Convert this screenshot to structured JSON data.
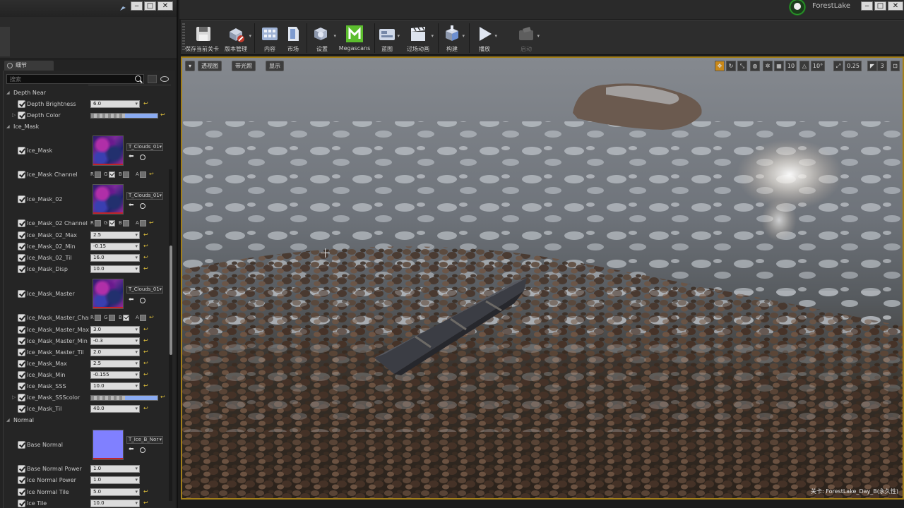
{
  "left_window": {
    "details_tab": "细节",
    "search": {
      "placeholder": "搜索"
    }
  },
  "details": {
    "categories": [
      "Depth Near",
      "Ice_Mask",
      "Normal"
    ],
    "rows": [
      {
        "label": "Depth Brightness",
        "value": "6.0"
      },
      {
        "label": "Depth Color"
      },
      {
        "label": "Ice_Mask",
        "asset": "T_Clouds_01"
      },
      {
        "label": "Ice_Mask Channel"
      },
      {
        "label": "Ice_Mask_02",
        "asset": "T_Clouds_01"
      },
      {
        "label": "Ice_Mask_02 Channel"
      },
      {
        "label": "Ice_Mask_02_Max",
        "value": "2.5"
      },
      {
        "label": "Ice_Mask_02_Min",
        "value": "-0.15"
      },
      {
        "label": "Ice_Mask_02_Til",
        "value": "16.0"
      },
      {
        "label": "Ice_Mask_Disp",
        "value": "10.0"
      },
      {
        "label": "Ice_Mask_Master",
        "asset": "T_Clouds_01"
      },
      {
        "label": "Ice_Mask_Master_Channe"
      },
      {
        "label": "Ice_Mask_Master_Max",
        "value": "3.0"
      },
      {
        "label": "Ice_Mask_Master_Min",
        "value": "-0.3"
      },
      {
        "label": "Ice_Mask_Master_Til",
        "value": "2.0"
      },
      {
        "label": "Ice_Mask_Max",
        "value": "2.5"
      },
      {
        "label": "Ice_Mask_Min",
        "value": "-0.155"
      },
      {
        "label": "Ice_Mask_SSS",
        "value": "10.0"
      },
      {
        "label": "Ice_Mask_SSScolor"
      },
      {
        "label": "Ice_Mask_Til",
        "value": "40.0"
      },
      {
        "label": "Base Normal",
        "asset": "T_Ice_B_Nor"
      },
      {
        "label": "Base Normal Power",
        "value": "1.0"
      },
      {
        "label": "Ice Normal Power",
        "value": "1.0"
      },
      {
        "label": "Ice Normal Tile",
        "value": "5.0"
      },
      {
        "label": "Ice Tile",
        "value": "10.0"
      }
    ],
    "channel_letters": {
      "r": "R",
      "g": "G",
      "b": "B",
      "a": "A"
    }
  },
  "main": {
    "project_name": "ForestLake",
    "toolbar": [
      {
        "label": "保存当前关卡",
        "icon": "save-icon"
      },
      {
        "label": "版本管理",
        "icon": "source-control-icon"
      },
      {
        "label": "内容",
        "icon": "content-browser-icon"
      },
      {
        "label": "市场",
        "icon": "marketplace-icon"
      },
      {
        "label": "设置",
        "icon": "settings-icon"
      },
      {
        "label": "Megascans",
        "icon": "megascans-icon"
      },
      {
        "label": "蓝图",
        "icon": "blueprint-icon"
      },
      {
        "label": "过场动画",
        "icon": "cinematics-icon"
      },
      {
        "label": "构建",
        "icon": "build-icon"
      },
      {
        "label": "播放",
        "icon": "play-icon"
      },
      {
        "label": "启动",
        "icon": "launch-icon"
      }
    ],
    "viewport": {
      "menu_buttons": [
        "透视图",
        "带光照",
        "显示"
      ],
      "grid_snap": "10",
      "rotation_snap": "10°",
      "scale_snap": "0.25",
      "camera_speed": "3",
      "level_label": "关卡:  ForestLake_Day_B(永久性)"
    }
  },
  "colors": {
    "viewport_border": "#a27f1a",
    "megascans_green": "#5cbd2e",
    "depth_color": "#8aabf2",
    "normal_map": "#8080ff"
  }
}
